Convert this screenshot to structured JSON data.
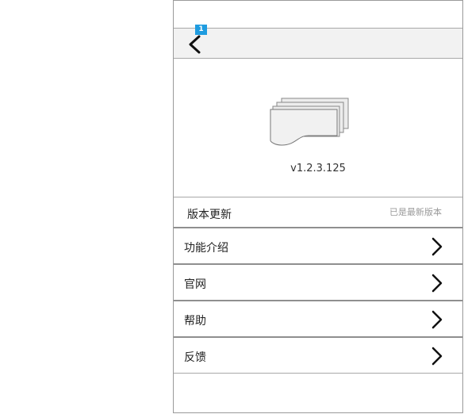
{
  "header": {
    "back_badge": "1"
  },
  "app": {
    "version": "v1.2.3.125"
  },
  "update": {
    "label": "版本更新",
    "status": "已是最新版本"
  },
  "menu": {
    "items": [
      {
        "label": "功能介绍"
      },
      {
        "label": "官网"
      },
      {
        "label": "帮助"
      },
      {
        "label": "反馈"
      }
    ]
  },
  "icons": {
    "back": "chevron-left-icon",
    "logo": "document-stack-icon",
    "item_arrow": "chevron-right-icon"
  },
  "colors": {
    "badge": "#1f9ce0",
    "header_bg": "#f2f2f2",
    "status_text": "#9a9a9a"
  }
}
